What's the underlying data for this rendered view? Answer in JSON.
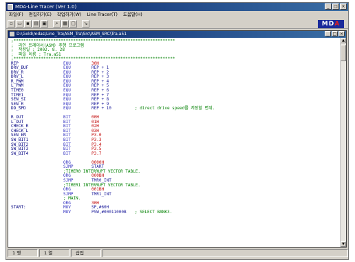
{
  "app": {
    "title": "MDA-Line Tracer (Ver 1.0)"
  },
  "menu": [
    "파일(F)",
    "편집하기(E)",
    "작업하기(W)",
    "Line Tracer(T)",
    "도움말(H)"
  ],
  "toolbar": {
    "buttons": [
      "new-icon",
      "open-icon",
      "save-icon",
      "print-icon",
      "preview-icon",
      "find-icon",
      "replace-icon",
      "stop-icon",
      "run-icon"
    ]
  },
  "logo": {
    "text_a": "MD",
    "text_b": "A",
    "brand_color": "#1a2a9a",
    "accent_color": "#e02020"
  },
  "document": {
    "path": "D:\\Gold\\mdas\\Line_Tra\\ASM_Tra\\Src\\ASM_SRC\\Tra.a51"
  },
  "code_lines": [
    [
      ";*****************************************************************",
      "",
      "",
      ""
    ],
    [
      ";  라인 트레이서(ASM) 주행 프로그램",
      "",
      "",
      ""
    ],
    [
      ";  작성일 : 2002. 8. 28",
      "",
      "",
      ""
    ],
    [
      ";  파일 이름 : Tra.a51",
      "",
      "",
      ""
    ],
    [
      ";*****************************************************************",
      "",
      "",
      ""
    ],
    [
      "REP",
      "EQU",
      "30H",
      ""
    ],
    [
      "DRV_BUF",
      "EQU",
      "REP + 1",
      ""
    ],
    [
      "DRV_R",
      "EQU",
      "REP + 2",
      ""
    ],
    [
      "DRV_L",
      "EQU",
      "REP + 3",
      ""
    ],
    [
      "R_PWM",
      "EQU",
      "REP + 4",
      ""
    ],
    [
      "L_PWM",
      "EQU",
      "REP + 5",
      ""
    ],
    [
      "TIME0",
      "EQU",
      "REP + 6",
      ""
    ],
    [
      "TIME1",
      "EQU",
      "REP + 7",
      ""
    ],
    [
      "SEN_SI",
      "EQU",
      "REP + 8",
      ""
    ],
    [
      "SEN_R",
      "EQU",
      "REP + 9",
      ""
    ],
    [
      "DD_SPD",
      "EQU",
      "REP + 10",
      "; direct drive speed를 저장할 변위."
    ],
    [
      "",
      "",
      "",
      ""
    ],
    [
      "R_OUT",
      "BIT",
      "00H",
      ""
    ],
    [
      "L_OUT",
      "BIT",
      "01H",
      ""
    ],
    [
      "CHECK_R",
      "BIT",
      "02H",
      ""
    ],
    [
      "CHECK_L",
      "BIT",
      "03H",
      ""
    ],
    [
      "SEN_EN",
      "BIT",
      "P3.0",
      ""
    ],
    [
      "SW_BIT1",
      "BIT",
      "P3.3",
      ""
    ],
    [
      "SW_BIT2",
      "BIT",
      "P3.4",
      ""
    ],
    [
      "SW_BIT3",
      "BIT",
      "P3.5",
      ""
    ],
    [
      "SW_BIT4",
      "BIT",
      "P3.7",
      ""
    ],
    [
      "",
      "",
      "",
      ""
    ],
    [
      "",
      "ORG",
      "0000H",
      ""
    ],
    [
      "",
      "SJMP",
      "START",
      ""
    ],
    [
      "",
      ";TIMER0 INTERRUPT VECTOR TABLE.",
      "",
      ""
    ],
    [
      "",
      "ORG",
      "000BH",
      ""
    ],
    [
      "",
      "SJMP",
      "TMR0_INT",
      ""
    ],
    [
      "",
      ";TIMER1 INTERRUPT VECTOR TABLE.",
      "",
      ""
    ],
    [
      "",
      "ORG",
      "001BH",
      ""
    ],
    [
      "",
      "SJMP",
      "TMR1_INT",
      ""
    ],
    [
      "",
      "; MAIN.",
      "",
      ""
    ],
    [
      "",
      "ORG",
      "30H",
      ""
    ],
    [
      "START:",
      "MOV",
      "SP,#60H",
      ""
    ],
    [
      "",
      "MOV",
      "PSW,#00011000B",
      "; SELECT BANK3."
    ]
  ],
  "status": [
    "1 행",
    "1 열",
    "삽입"
  ]
}
